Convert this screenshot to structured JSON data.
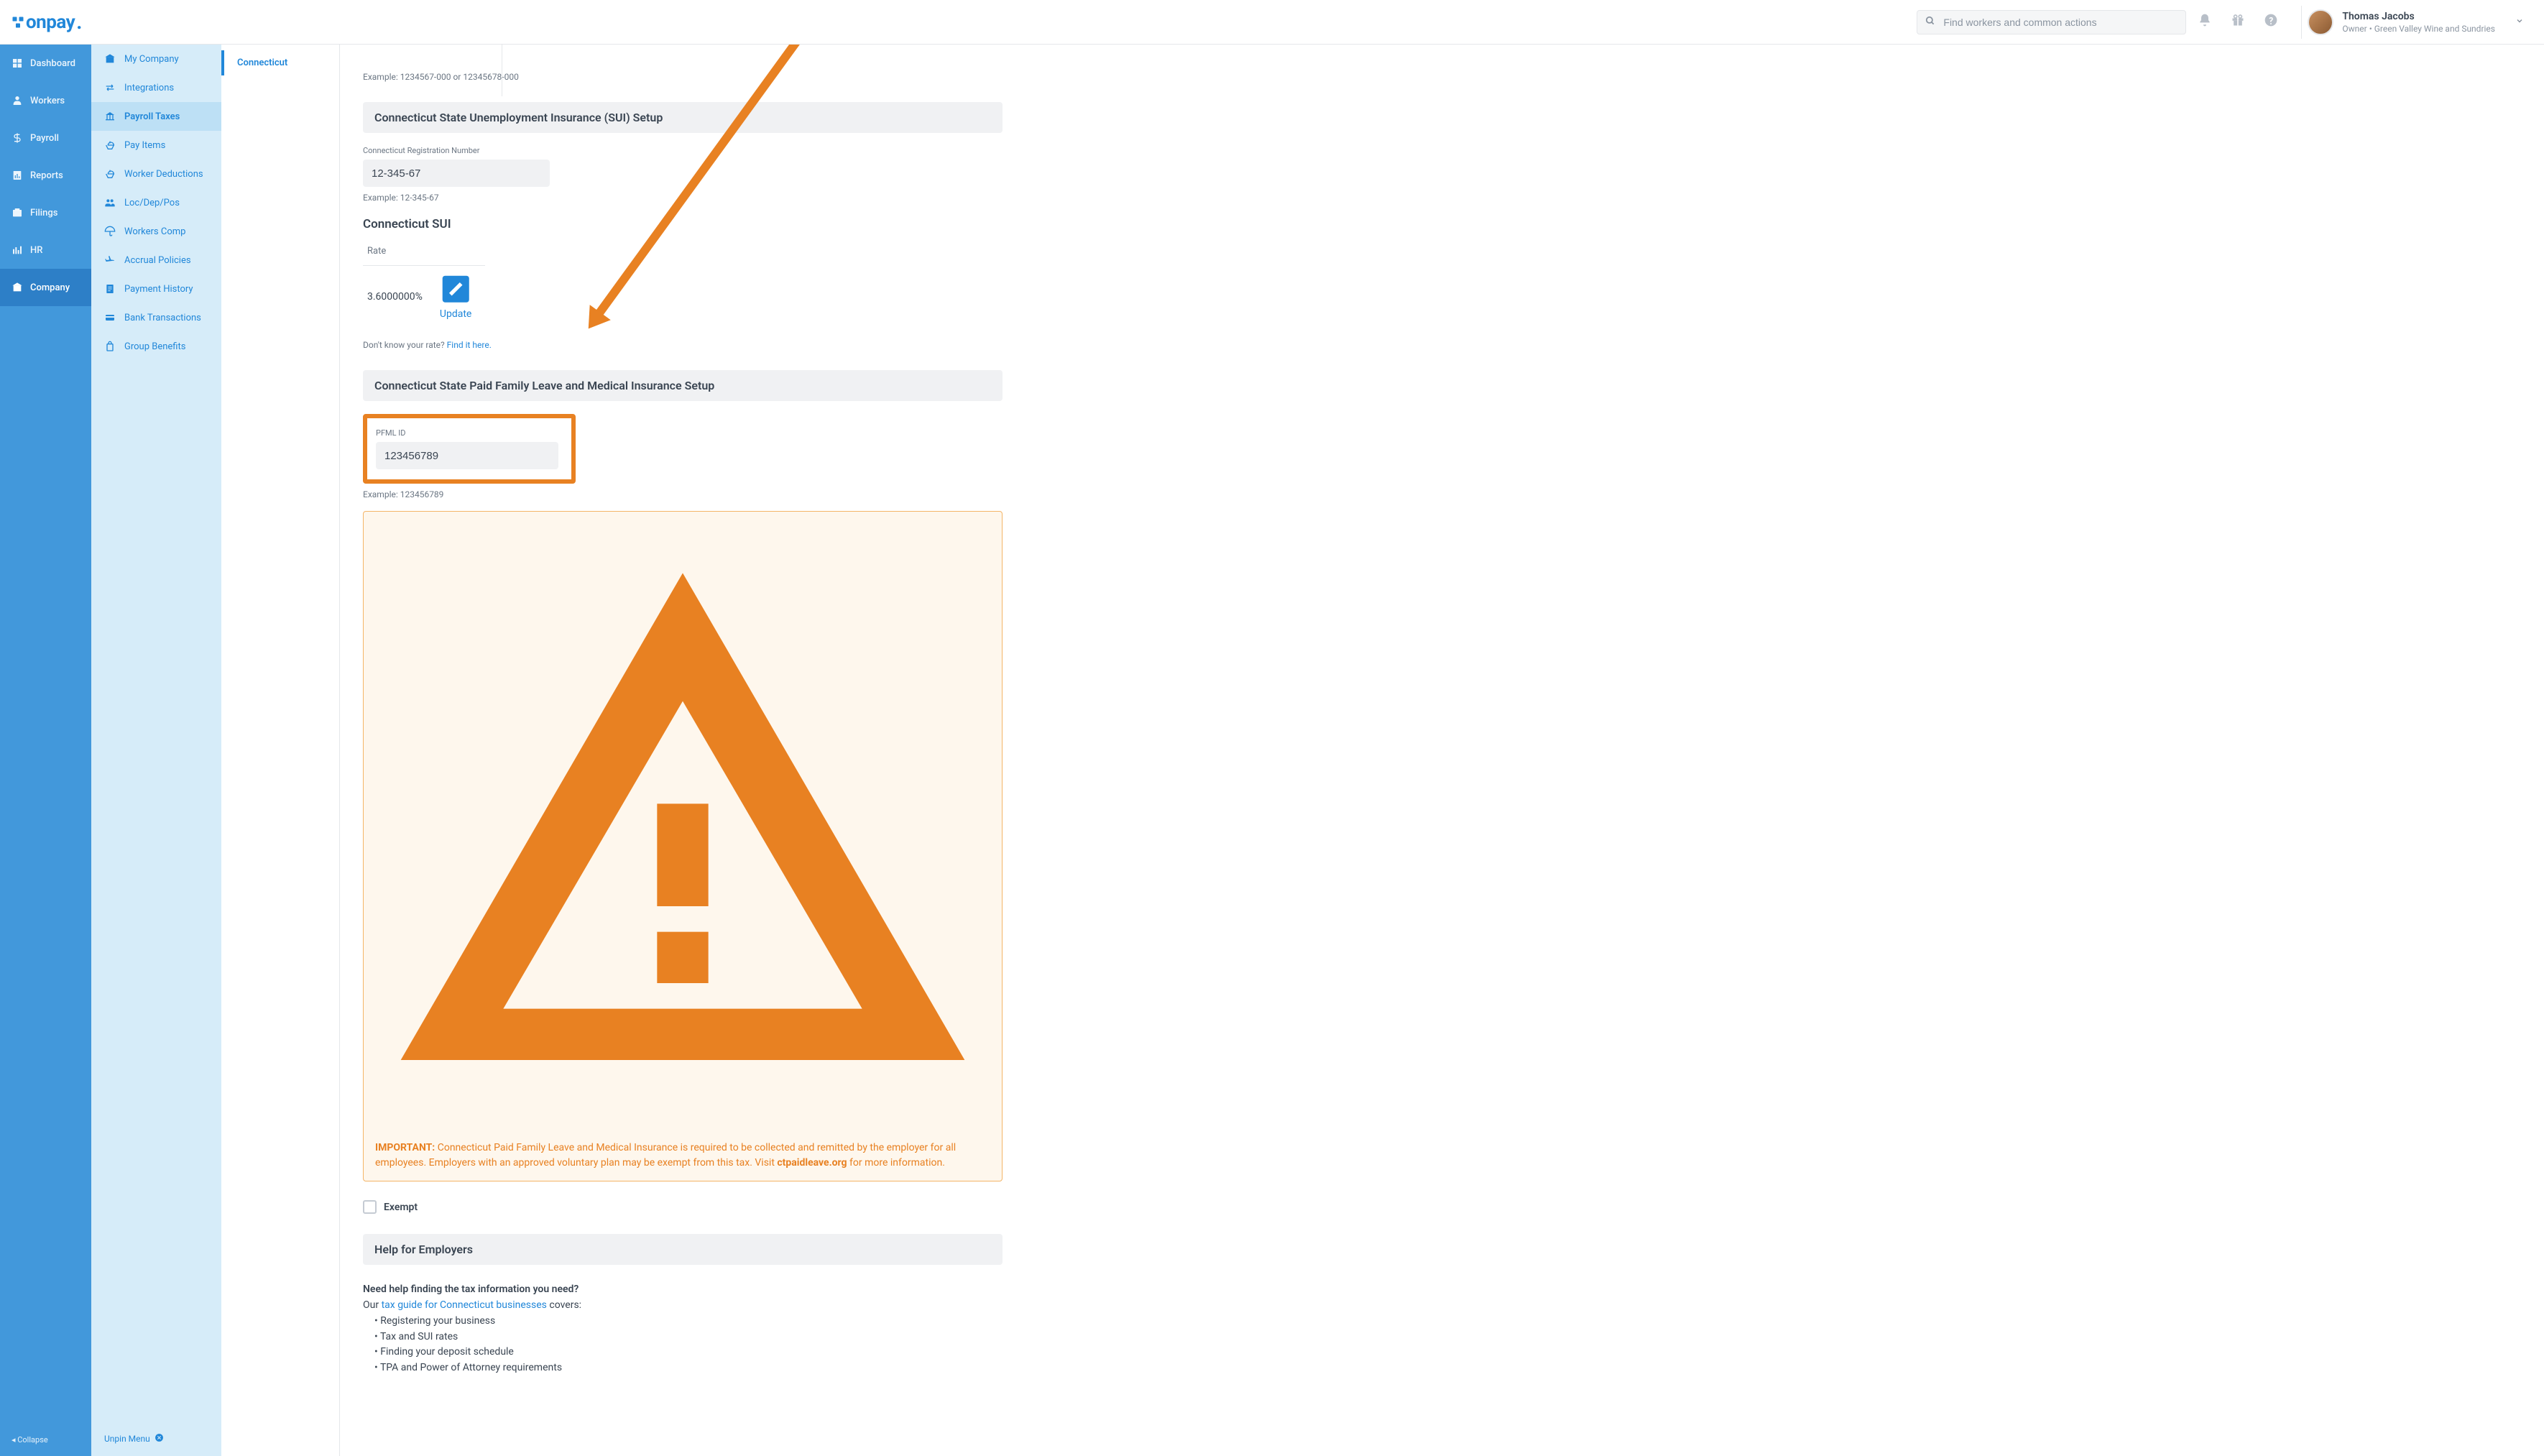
{
  "header": {
    "searchPlaceholder": "Find workers and common actions",
    "user": {
      "name": "Thomas Jacobs",
      "role": "Owner",
      "company": "Green Valley Wine and Sundries"
    }
  },
  "primaryNav": {
    "items": [
      {
        "label": "Dashboard"
      },
      {
        "label": "Workers"
      },
      {
        "label": "Payroll"
      },
      {
        "label": "Reports"
      },
      {
        "label": "Filings"
      },
      {
        "label": "HR"
      },
      {
        "label": "Company"
      }
    ],
    "collapse": "Collapse"
  },
  "secondaryNav": {
    "items": [
      {
        "label": "My Company"
      },
      {
        "label": "Integrations"
      },
      {
        "label": "Payroll Taxes"
      },
      {
        "label": "Pay Items"
      },
      {
        "label": "Worker Deductions"
      },
      {
        "label": "Loc/Dep/Pos"
      },
      {
        "label": "Workers Comp"
      },
      {
        "label": "Accrual Policies"
      },
      {
        "label": "Payment History"
      },
      {
        "label": "Bank Transactions"
      },
      {
        "label": "Group Benefits"
      }
    ],
    "unpin": "Unpin Menu"
  },
  "tertiary": {
    "item": "Connecticut"
  },
  "content": {
    "exampleTop": "Example: 1234567-000 or 12345678-000",
    "suiSection": {
      "title": "Connecticut State Unemployment Insurance (SUI) Setup",
      "regLabel": "Connecticut Registration Number",
      "regValue": "12-345-67",
      "regExample": "Example: 12-345-67",
      "suiTitle": "Connecticut SUI",
      "rateHeader": "Rate",
      "rateValue": "3.6000000%",
      "updateLabel": "Update",
      "rateHelp": "Don't know your rate? ",
      "rateHelpLink": "Find it here."
    },
    "pfmlSection": {
      "title": "Connecticut State Paid Family Leave and Medical Insurance Setup",
      "idLabel": "PFML ID",
      "idValue": "123456789",
      "idExample": "Example: 123456789",
      "alertPrefix": "IMPORTANT: ",
      "alertBody": "Connecticut Paid Family Leave and Medical Insurance is required to be collected and remitted by the employer for all employees. Employers with an approved voluntary plan may be exempt from this tax. Visit ",
      "alertLink": "ctpaidleave.org",
      "alertSuffix": " for more information.",
      "exemptLabel": "Exempt"
    },
    "helpSection": {
      "title": "Help for Employers",
      "q": "Need help finding the tax information you need?",
      "ourText": "Our ",
      "guideLink": "tax guide for Connecticut businesses",
      "coversText": " covers:",
      "bullets": [
        "Registering your business",
        "Tax and SUI rates",
        "Finding your deposit schedule",
        "TPA and Power of Attorney requirements"
      ]
    }
  }
}
